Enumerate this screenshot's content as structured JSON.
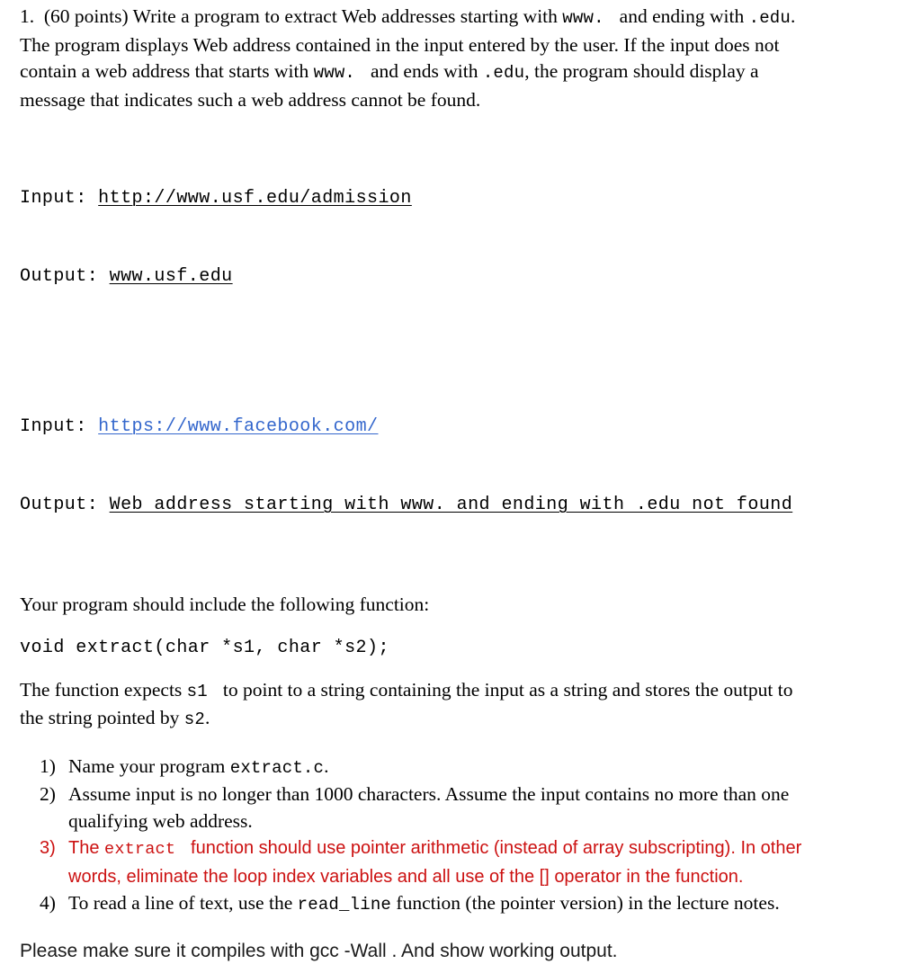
{
  "document": {
    "question_number": "1.",
    "points_label": "(60 points)",
    "intro": {
      "part1": "Write a program to extract Web addresses starting with ",
      "code1": "www.",
      "part2": " and ending with ",
      "code2": ".edu",
      "part3": ". The program displays Web address contained in the input entered by the user. If the input does not contain a web address that starts with ",
      "code3": "www.",
      "part4": " and ends with ",
      "code4": ".edu",
      "part5": ", the program should display a message that indicates such a web address cannot be found."
    },
    "examples": [
      {
        "input_label": "Input:",
        "input_value": "http://www.usf.edu/admission",
        "input_style": "black-underline",
        "output_label": "Output:",
        "output_value": "www.usf.edu",
        "output_style": "black-underline"
      },
      {
        "input_label": "Input:",
        "input_value": "https://www.facebook.com/",
        "input_style": "blue-link",
        "output_label": "Output:",
        "output_value": "Web address starting with www. and ending with .edu not found",
        "output_style": "black-underline"
      }
    ],
    "function_intro": "Your program should include the following function:",
    "function_signature": "void extract(char *s1, char *s2);",
    "function_description": {
      "part1": "The function expects ",
      "code1": "s1",
      "part2": " to point to a string containing the input as a string and stores the output to the string pointed by ",
      "code2": "s2",
      "part3": "."
    },
    "requirements": [
      {
        "marker": "1)",
        "color": "black",
        "part1": "Name your program ",
        "code1": "extract.c",
        "part2": "."
      },
      {
        "marker": "2)",
        "color": "black",
        "part1": "Assume input is no longer than 1000 characters. Assume the input contains no more than one qualifying web address.",
        "code1": "",
        "part2": ""
      },
      {
        "marker": "3)",
        "color": "#cc1111",
        "part1": "The ",
        "code1": "extract",
        "part2": " function should use pointer arithmetic (instead of array subscripting). In other words, eliminate the loop index variables and all use of the [] operator in the function."
      },
      {
        "marker": "4)",
        "color": "black",
        "part1": "To read a line of text, use the ",
        "code1": "read_line",
        "part2": " function (the pointer version) in the lecture notes."
      }
    ],
    "closing_note": "Please make sure it compiles with gcc -Wall . And show working output.",
    "colors": {
      "text": "#000000",
      "link": "#3366cc",
      "highlight_red": "#cc1111",
      "background": "#ffffff"
    }
  }
}
